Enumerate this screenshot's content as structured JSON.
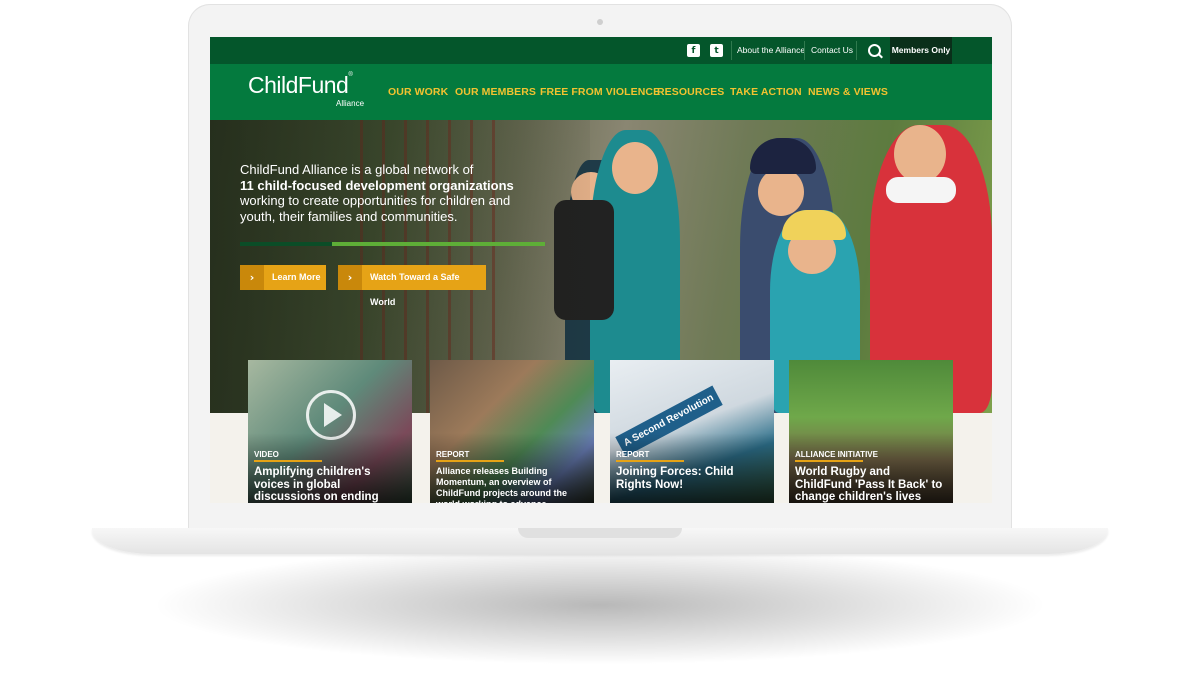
{
  "topbar": {
    "facebook_icon": "facebook-icon",
    "twitter_icon": "twitter-icon",
    "links": [
      "About the Alliance",
      "Contact Us"
    ],
    "search_icon": "search-icon",
    "members_label": "Members Only"
  },
  "logo": {
    "name": "ChildFund",
    "subtitle": "Alliance",
    "reg": "®"
  },
  "nav": {
    "items": [
      "OUR WORK",
      "OUR MEMBERS",
      "FREE FROM VIOLENCE",
      "RESOURCES",
      "TAKE ACTION",
      "NEWS & VIEWS"
    ]
  },
  "hero": {
    "line1": "ChildFund Alliance is a global network of",
    "line2": "11 child-focused development organizations",
    "line3": "working to create opportunities for children and youth, their families and communities.",
    "cta1": "Learn More",
    "cta2": "Watch Toward a Safe World"
  },
  "cards": [
    {
      "tag": "VIDEO",
      "title": "Amplifying children's voices in global discussions on ending violence against children"
    },
    {
      "tag": "REPORT",
      "title": "Alliance releases Building Momentum, an overview of ChildFund projects around the world working to advance"
    },
    {
      "tag": "REPORT",
      "title": "Joining Forces: Child Rights Now!",
      "cover_text": "A Second Revolution"
    },
    {
      "tag": "ALLIANCE INITIATIVE",
      "title": "World Rugby and ChildFund 'Pass It Back' to change children's lives through sport"
    }
  ],
  "colors": {
    "topbar": "#04562b",
    "nav": "#047a3e",
    "nav_text": "#f2c230",
    "cta": "#e6a316",
    "members": "#0a2f1a"
  }
}
